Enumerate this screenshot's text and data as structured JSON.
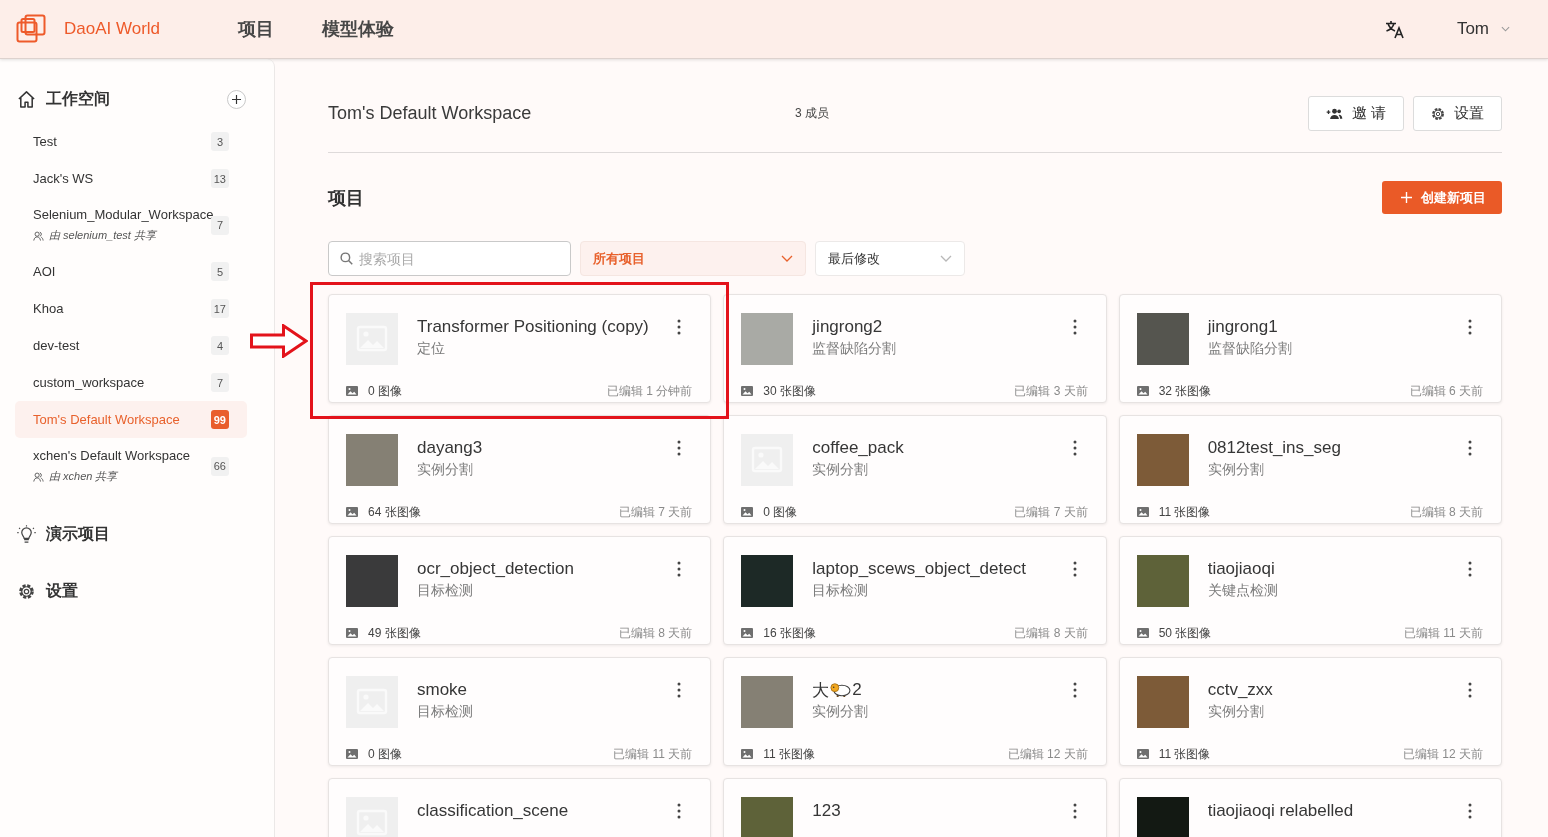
{
  "brand": {
    "name": "DaoAI World"
  },
  "nav": [
    {
      "label": "项目"
    },
    {
      "label": "模型体验"
    }
  ],
  "user": {
    "name": "Tom"
  },
  "sidebar": {
    "title": "工作空间",
    "workspaces": [
      {
        "name": "Test",
        "count": "3",
        "selected": false
      },
      {
        "name": "Jack's WS",
        "count": "13",
        "selected": false
      },
      {
        "name": "Selenium_Modular_Workspace",
        "count": "7",
        "shared_by": "由 selenium_test 共享",
        "selected": false
      },
      {
        "name": "AOI",
        "count": "5",
        "selected": false
      },
      {
        "name": "Khoa",
        "count": "17",
        "selected": false
      },
      {
        "name": "dev-test",
        "count": "4",
        "selected": false
      },
      {
        "name": "custom_workspace",
        "count": "7",
        "selected": false
      },
      {
        "name": "Tom's Default Workspace",
        "count": "99",
        "selected": true
      },
      {
        "name": "xchen's Default Workspace",
        "count": "66",
        "shared_by": "由 xchen 共享",
        "selected": false
      }
    ],
    "links": [
      {
        "label": "演示项目",
        "kind": "demo"
      },
      {
        "label": "设置",
        "kind": "settings"
      }
    ]
  },
  "workspace": {
    "title": "Tom's Default Workspace",
    "members": "3 成员",
    "buttons": [
      {
        "label": "邀 请",
        "kind": "invite"
      },
      {
        "label": "设置",
        "kind": "settings"
      }
    ]
  },
  "projects": {
    "title": "项目",
    "create_button": "创建新项目",
    "search": {
      "placeholder": "搜索项目"
    },
    "filters": [
      {
        "label": "所有项目",
        "selected": true
      },
      {
        "label": "最后修改",
        "selected": false
      }
    ],
    "cards": [
      {
        "title": "Transformer Positioning (copy)",
        "type": "定位",
        "thumbnail": {
          "kind": "empty"
        },
        "images": "0 图像",
        "edited": "已编辑 1 分钟前",
        "highlighted": true
      },
      {
        "title": "jingrong2",
        "type": "监督缺陷分割",
        "thumbnail": {
          "kind": "metal"
        },
        "images": "30 张图像",
        "edited": "已编辑 3 天前",
        "highlighted": false
      },
      {
        "title": "jingrong1",
        "type": "监督缺陷分割",
        "thumbnail": {
          "kind": "slate"
        },
        "images": "32 张图像",
        "edited": "已编辑 6 天前",
        "highlighted": false
      },
      {
        "title": "dayang3",
        "type": "实例分割",
        "thumbnail": {
          "kind": "concrete"
        },
        "images": "64 张图像",
        "edited": "已编辑 7 天前",
        "highlighted": false
      },
      {
        "title": "coffee_pack",
        "type": "实例分割",
        "thumbnail": {
          "kind": "empty"
        },
        "images": "0 图像",
        "edited": "已编辑 7 天前",
        "highlighted": false
      },
      {
        "title": "0812test_ins_seg",
        "type": "实例分割",
        "thumbnail": {
          "kind": "board"
        },
        "images": "11 张图像",
        "edited": "已编辑 8 天前",
        "highlighted": false
      },
      {
        "title": "ocr_object_detection",
        "type": "目标检测",
        "thumbnail": {
          "kind": "fabric"
        },
        "images": "49 张图像",
        "edited": "已编辑 8 天前",
        "highlighted": false
      },
      {
        "title": "laptop_scews_object_detect",
        "type": "目标检测",
        "thumbnail": {
          "kind": "circuit"
        },
        "images": "16 张图像",
        "edited": "已编辑 8 天前",
        "highlighted": false
      },
      {
        "title": "tiaojiaoqi",
        "type": "关键点检测",
        "thumbnail": {
          "kind": "moss"
        },
        "images": "50 张图像",
        "edited": "已编辑 11 天前",
        "highlighted": false
      },
      {
        "title": "smoke",
        "type": "目标检测",
        "thumbnail": {
          "kind": "empty"
        },
        "images": "0 图像",
        "edited": "已编辑 11 天前",
        "highlighted": false
      },
      {
        "title": "大",
        "title_emoji": true,
        "title_suffix": "2",
        "type": "实例分割",
        "thumbnail": {
          "kind": "concrete"
        },
        "images": "11 张图像",
        "edited": "已编辑 12 天前",
        "highlighted": false
      },
      {
        "title": "cctv_zxx",
        "type": "实例分割",
        "thumbnail": {
          "kind": "board"
        },
        "images": "11 张图像",
        "edited": "已编辑 12 天前",
        "highlighted": false
      },
      {
        "title": "classification_scene",
        "thumbnail": {
          "kind": "empty"
        },
        "highlighted": false
      },
      {
        "title": "123",
        "thumbnail": {
          "kind": "moss"
        },
        "highlighted": false
      },
      {
        "title": "tiaojiaoqi relabelled",
        "thumbnail": {
          "kind": "night"
        },
        "highlighted": false
      }
    ]
  }
}
